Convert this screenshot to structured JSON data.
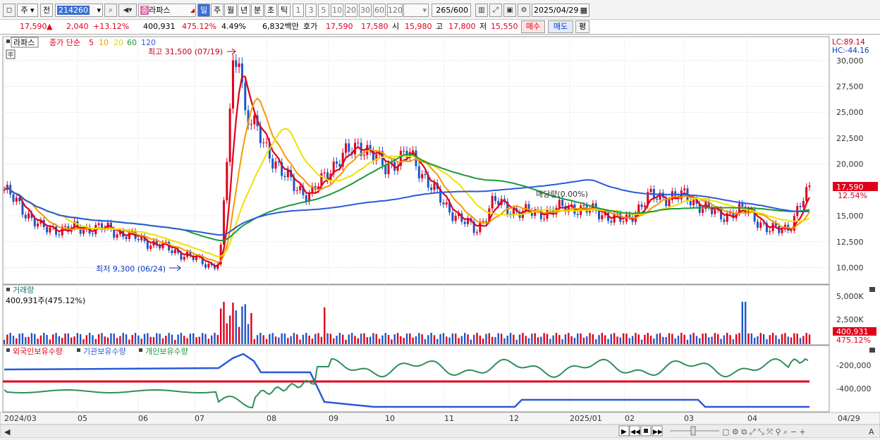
{
  "toolbar": {
    "period_type": "주",
    "prev_label": "전",
    "stock_code": "214260",
    "stock_name": "라파스",
    "stock_badge": "종",
    "period_tabs": [
      "일",
      "주",
      "월",
      "년",
      "분",
      "초",
      "틱"
    ],
    "active_period": "일",
    "interval_buttons": [
      "1",
      "3",
      "5",
      "10",
      "20",
      "30",
      "60",
      "120"
    ],
    "count": "265",
    "count_total": "/600",
    "date": "2025/04/29"
  },
  "quote": {
    "price": "17,590",
    "change": "2,040",
    "change_pct": "+13.12%",
    "volume": "400,931",
    "volume_pct": "475.12%",
    "turnover": "4.49%",
    "amount": "6,832백만",
    "bid_label": "호가",
    "ask": "17,590",
    "bid": "17,580",
    "open_label": "시",
    "open": "15,980",
    "high_label": "고",
    "high": "17,800",
    "low_label": "저",
    "low": "15,550",
    "buy_label": "매수",
    "sell_label": "매도",
    "avg_label": "평"
  },
  "legend": {
    "name": "라파스",
    "line_label": "종가 단순",
    "ma": [
      "5",
      "10",
      "20",
      "60",
      "120"
    ],
    "ma_colors": [
      "#e0001b",
      "#f59a00",
      "#f0e000",
      "#1a9a3a",
      "#2a5ad8"
    ]
  },
  "annotations": {
    "high": "최고 31,500 (07/19)",
    "low": "최저 9,300 (06/24)",
    "matching": "매당량(0.00%)",
    "lc": "LC:89.14",
    "hc": "HC:-44.16",
    "price_tag": "17,590",
    "price_pct_tag": "12.54%"
  },
  "volume": {
    "title": "거래량",
    "value": "400,931주(475.12%)",
    "tag": "400,931",
    "tag_pct": "475.12%",
    "ticks": [
      "5,000K",
      "2,500K"
    ]
  },
  "holdings": {
    "series": [
      "외국인보유수량",
      "기관보유수량",
      "개인보유수량"
    ],
    "ticks": [
      "-200,000",
      "-400,000"
    ]
  },
  "x_labels": [
    "2024/03",
    "05",
    "06",
    "07",
    "08",
    "09",
    "10",
    "11",
    "12",
    "2025/01",
    "02",
    "03",
    "04"
  ],
  "right_date": "04/29",
  "chart_data": {
    "type": "candlestick",
    "y_ticks": [
      30000,
      27500,
      25000,
      22500,
      20000,
      15000,
      12500,
      10000
    ],
    "ylim": [
      8400,
      32300
    ],
    "close_by_month": [
      {
        "label": "2024/03",
        "close": 17500
      },
      {
        "label": "05",
        "close": 13700
      },
      {
        "label": "06",
        "close": 11800
      },
      {
        "label": "07",
        "close": 10200
      },
      {
        "label": "07/19",
        "close": 31500
      },
      {
        "label": "08",
        "close": 19000
      },
      {
        "label": "09",
        "close": 19500
      },
      {
        "label": "10",
        "close": 19700
      },
      {
        "label": "11",
        "close": 14400
      },
      {
        "label": "12",
        "close": 15600
      },
      {
        "label": "2025/01",
        "close": 15900
      },
      {
        "label": "02",
        "close": 16800
      },
      {
        "label": "03",
        "close": 16400
      },
      {
        "label": "04",
        "close": 13500
      },
      {
        "label": "04/29",
        "close": 17590
      }
    ],
    "high": 31500,
    "low": 9300,
    "last": 17590
  }
}
